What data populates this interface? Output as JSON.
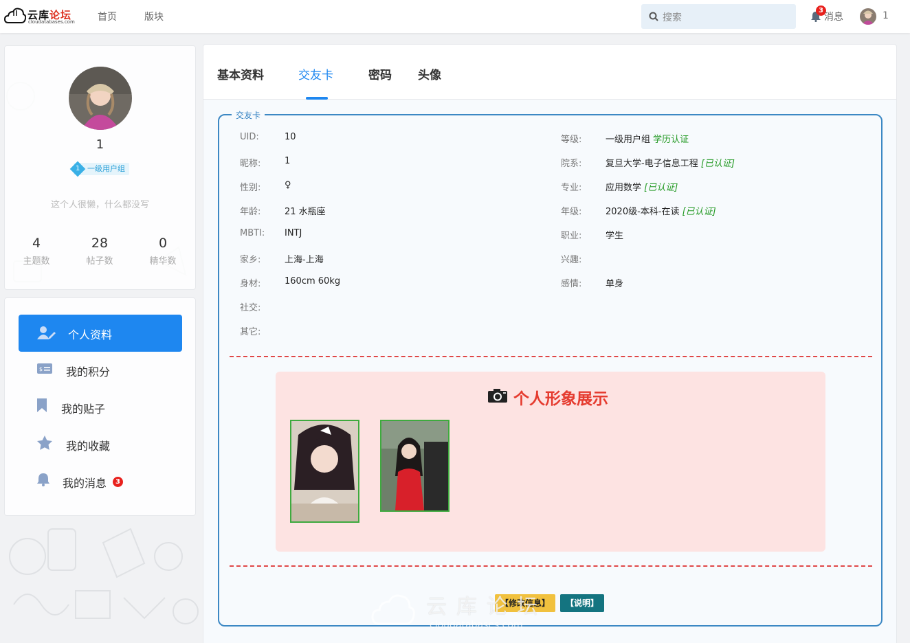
{
  "header": {
    "logo_name_a": "云库",
    "logo_name_b": "论坛",
    "logo_url": "cloudatabases.com",
    "nav": [
      "首页",
      "版块"
    ],
    "search_placeholder": "搜索",
    "messages_label": "消息",
    "messages_count": "3",
    "username": "1"
  },
  "profile": {
    "name": "1",
    "group_level": "1",
    "group": "一级用户组",
    "signature": "这个人很懒，什么都没写",
    "stats": [
      {
        "value": "4",
        "label": "主题数"
      },
      {
        "value": "28",
        "label": "帖子数"
      },
      {
        "value": "0",
        "label": "精华数"
      }
    ]
  },
  "menu": {
    "items": [
      {
        "label": "个人资料",
        "icon": "user-edit-icon"
      },
      {
        "label": "我的积分",
        "icon": "wallet-icon"
      },
      {
        "label": "我的贴子",
        "icon": "bookmark-icon"
      },
      {
        "label": "我的收藏",
        "icon": "star-icon"
      },
      {
        "label": "我的消息",
        "icon": "bell-icon",
        "badge": "3"
      }
    ]
  },
  "tabs": [
    "基本资料",
    "交友卡",
    "密码",
    "头像"
  ],
  "card": {
    "legend": "交友卡",
    "left": [
      {
        "k": "UID:",
        "v": "10"
      },
      {
        "k": "昵称:",
        "v": "1"
      },
      {
        "k": "性别:",
        "v": "♀"
      },
      {
        "k": "年龄:",
        "v": "21 水瓶座"
      },
      {
        "k": "MBTI:",
        "v": "INTJ"
      },
      {
        "k": "家乡:",
        "v": "上海-上海"
      },
      {
        "k": "身材:",
        "v": "160cm 60kg"
      },
      {
        "k": "社交:",
        "v": ""
      },
      {
        "k": "其它:",
        "v": ""
      }
    ],
    "right": [
      {
        "k": "等级:",
        "v": "一级用户组",
        "extra": "学历认证"
      },
      {
        "k": "院系:",
        "v": "复旦大学-电子信息工程",
        "verify": "[已认证]"
      },
      {
        "k": "专业:",
        "v": "应用数学",
        "verify": "[已认证]"
      },
      {
        "k": "年级:",
        "v": "2020级-本科-在读",
        "verify": "[已认证]"
      },
      {
        "k": "职业:",
        "v": "学生"
      },
      {
        "k": "兴趣:",
        "v": ""
      },
      {
        "k": "感情:",
        "v": "单身"
      }
    ],
    "showcase_title": "个人形象展示",
    "btn_edit": "【修改信息】",
    "btn_help": "【说明】"
  },
  "watermark": {
    "text": "云库论坛",
    "url": "cloudatabases.com"
  },
  "colors": {
    "accent": "#1e87f0",
    "verified": "#229922",
    "showcase_bg": "#fde3e2",
    "showcase_title": "#e53b2f",
    "fieldset_border": "#3c88c4",
    "dashed": "#e04646"
  }
}
